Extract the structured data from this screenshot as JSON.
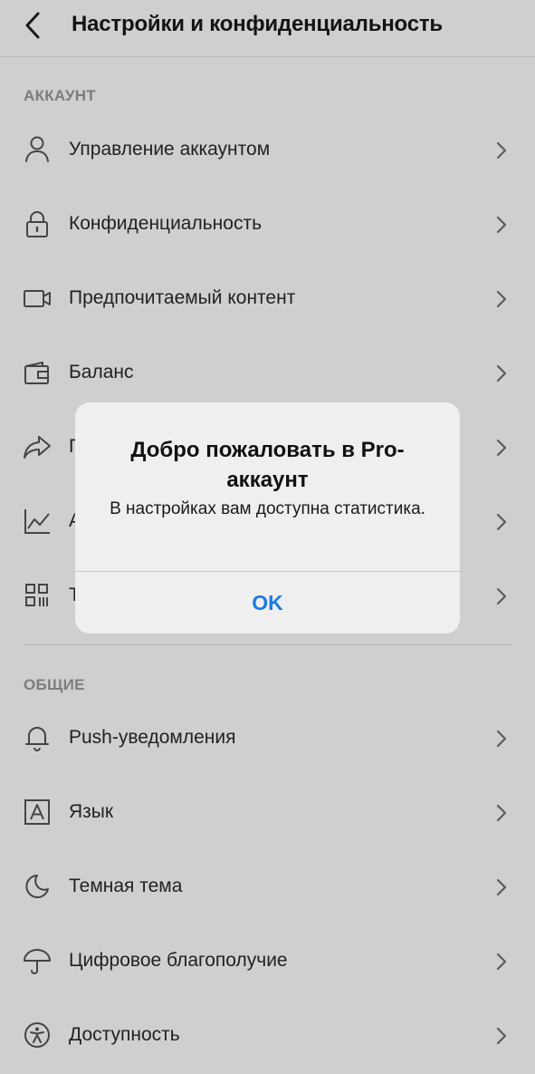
{
  "header": {
    "title": "Настройки и конфиденциальность"
  },
  "sections": {
    "account": {
      "title": "АККАУНТ",
      "items": [
        {
          "icon": "person-icon",
          "label": "Управление аккаунтом"
        },
        {
          "icon": "lock-icon",
          "label": "Конфиденциальность"
        },
        {
          "icon": "video-camera-icon",
          "label": "Предпочитаемый контент"
        },
        {
          "icon": "wallet-icon",
          "label": "Баланс"
        },
        {
          "icon": "share-icon",
          "label": "П"
        },
        {
          "icon": "analytics-icon",
          "label": "А"
        },
        {
          "icon": "qr-code-icon",
          "label": "Т"
        }
      ]
    },
    "general": {
      "title": "ОБЩИЕ",
      "items": [
        {
          "icon": "bell-icon",
          "label": "Push-уведомления"
        },
        {
          "icon": "language-icon",
          "label": "Язык"
        },
        {
          "icon": "moon-icon",
          "label": "Темная тема"
        },
        {
          "icon": "umbrella-icon",
          "label": "Цифровое благополучие"
        },
        {
          "icon": "accessibility-icon",
          "label": "Доступность"
        }
      ]
    }
  },
  "alert": {
    "title": "Добро пожаловать в Pro-аккаунт",
    "message": "В настройках вам доступна статистика.",
    "ok_label": "OK"
  },
  "colors": {
    "background": "#cfcfcf",
    "alert_background": "#efefef",
    "accent": "#1f7ae0"
  }
}
